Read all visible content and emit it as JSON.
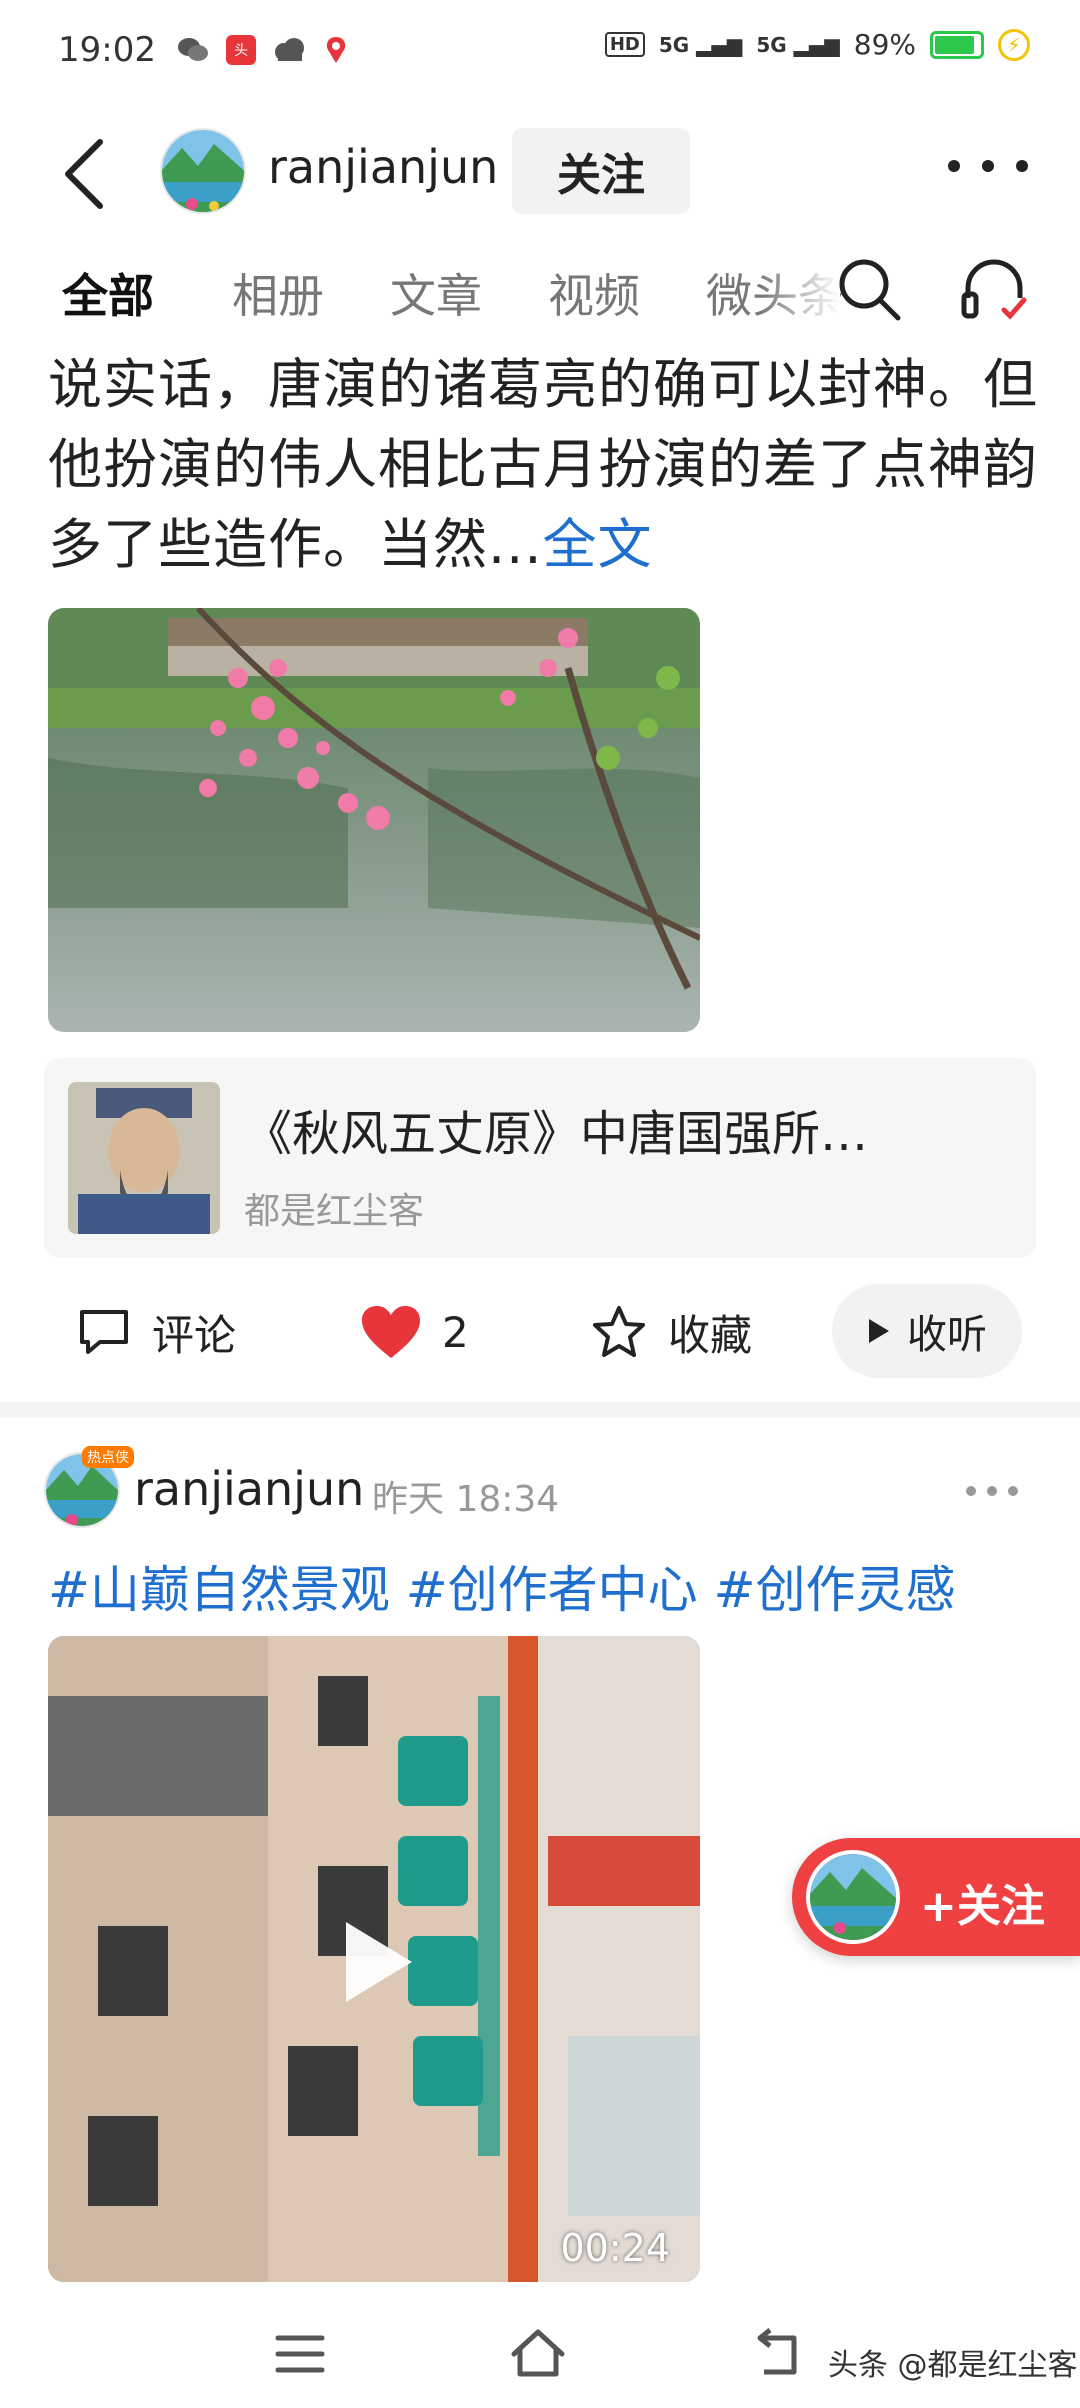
{
  "status_bar": {
    "time": "19:02",
    "app_icons": [
      "wechat-icon",
      "toutiao-icon",
      "cloud-icon",
      "location-icon"
    ],
    "network_hd": "HD",
    "signal_1": "5G",
    "signal_2": "5G",
    "battery": "89%",
    "battery_level": 0.89
  },
  "header": {
    "username": "ranjianjun",
    "follow_label": "关注"
  },
  "tabs": [
    {
      "label": "全部",
      "active": true
    },
    {
      "label": "相册",
      "active": false
    },
    {
      "label": "文章",
      "active": false
    },
    {
      "label": "视频",
      "active": false
    },
    {
      "label": "微头条",
      "active": false
    }
  ],
  "post1": {
    "text": "说实话，唐演的诸葛亮的确可以封神。但他扮演的伟人相比古月扮演的差了点神韵多了些造作。当然...",
    "full_text_link": "全文",
    "link_card": {
      "title": "《秋风五丈原》中唐国强所…",
      "author": "都是红尘客"
    },
    "actions": {
      "comment": "评论",
      "likes": "2",
      "favorite": "收藏",
      "listen": "收听"
    }
  },
  "post2": {
    "badge": "热点侠",
    "username": "ranjianjun",
    "time_day": "昨天",
    "time": "18:34",
    "hashtags": "#山巅自然景观 #创作者中心 #创作灵感",
    "video_duration": "00:24"
  },
  "floating_follow": {
    "label": "+关注"
  },
  "watermark": "头条 @都是红尘客",
  "colors": {
    "link_blue": "#1f6fcf",
    "like_red": "#e8353b",
    "follow_red": "#f04142"
  }
}
